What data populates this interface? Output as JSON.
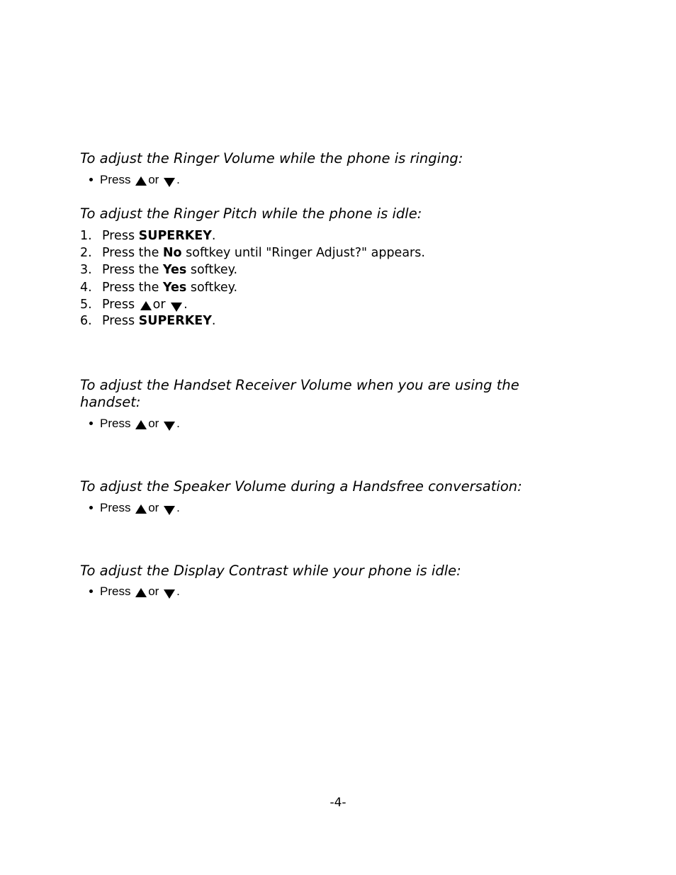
{
  "sections": [
    {
      "heading": "To adjust the Ringer Volume while the phone is ringing:",
      "bullets": [
        {
          "press": "Press",
          "or": "or",
          "end": "."
        }
      ]
    },
    {
      "heading": "To adjust the Ringer Pitch while the phone is idle:",
      "steps": [
        {
          "num": "1.",
          "pre": "Press ",
          "bold": "SUPERKEY",
          "post": "."
        },
        {
          "num": "2.",
          "pre": "Press the ",
          "bold": "No",
          "post": " softkey until \"Ringer Adjust?\" appears."
        },
        {
          "num": "3.",
          "pre": "Press the ",
          "bold": "Yes",
          "post": " softkey."
        },
        {
          "num": "4.",
          "pre": "Press the ",
          "bold": "Yes",
          "post": " softkey."
        },
        {
          "num": "5.",
          "pre": "Press",
          "or": "or",
          "post": "."
        },
        {
          "num": "6.",
          "pre": "Press ",
          "bold": "SUPERKEY",
          "post": "."
        }
      ]
    },
    {
      "heading_line1": "To adjust the Handset Receiver Volume when you are using the",
      "heading_line2": "handset:",
      "bullets": [
        {
          "press": "Press",
          "or": "or",
          "end": "."
        }
      ]
    },
    {
      "heading": "To adjust the Speaker Volume during a Handsfree conversation:",
      "bullets": [
        {
          "press": "Press",
          "or": "or",
          "end": "."
        }
      ]
    },
    {
      "heading": "To adjust the Display Contrast while your phone is idle:",
      "bullets": [
        {
          "press": "Press",
          "or": "or",
          "end": "."
        }
      ]
    }
  ],
  "icons": {
    "up": "up-arrow-icon",
    "down": "down-arrow-icon"
  },
  "page_number": "-4-"
}
